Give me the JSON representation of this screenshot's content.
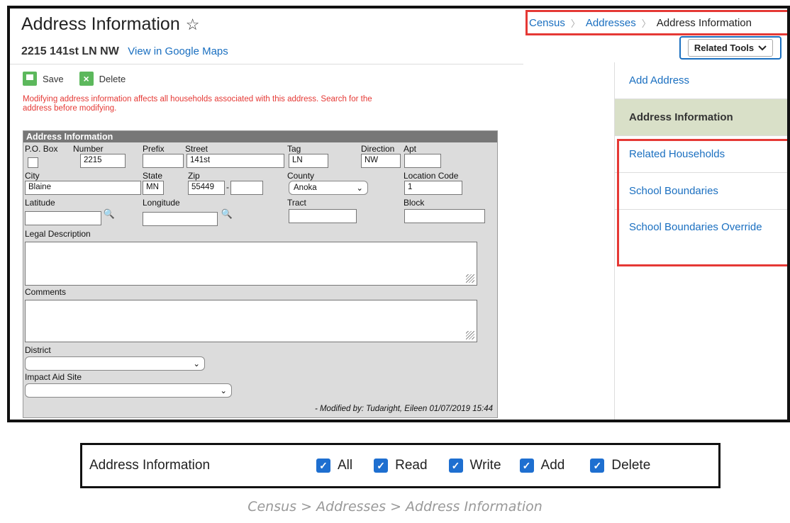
{
  "page": {
    "title": "Address Information",
    "address_line": "2215 141st LN NW",
    "maps_link": "View in Google Maps"
  },
  "breadcrumb": {
    "items": [
      "Census",
      "Addresses",
      "Address Information"
    ]
  },
  "related_tools": {
    "label": "Related Tools"
  },
  "right_panel": {
    "items": [
      {
        "label": "Add Address"
      },
      {
        "label": "Address Information"
      },
      {
        "label": "Related Households"
      },
      {
        "label": "School Boundaries"
      },
      {
        "label": "School Boundaries Override"
      }
    ]
  },
  "toolbar": {
    "save": "Save",
    "delete": "Delete"
  },
  "warning": "Modifying address information affects all households associated with this address. Search for the address before modifying.",
  "form": {
    "header": "Address Information",
    "labels": {
      "po_box": "P.O. Box",
      "number": "Number",
      "prefix": "Prefix",
      "street": "Street",
      "tag": "Tag",
      "direction": "Direction",
      "apt": "Apt",
      "city": "City",
      "state": "State",
      "zip": "Zip",
      "county": "County",
      "location_code": "Location Code",
      "latitude": "Latitude",
      "longitude": "Longitude",
      "tract": "Tract",
      "block": "Block",
      "legal_description": "Legal Description",
      "comments": "Comments",
      "district": "District",
      "impact_aid": "Impact Aid Site"
    },
    "values": {
      "number": "2215",
      "prefix": "",
      "street": "141st",
      "tag": "LN",
      "direction": "NW",
      "apt": "",
      "city": "Blaine",
      "state": "MN",
      "zip": "55449",
      "zip_ext": "",
      "county": "Anoka",
      "location_code": "1",
      "latitude": "",
      "longitude": "",
      "tract": "",
      "block": "",
      "district": "",
      "impact_aid": ""
    },
    "modified": "- Modified by: Tudaright, Eileen 01/07/2019 15:44"
  },
  "permissions": {
    "name": "Address Information",
    "options": [
      {
        "label": "All",
        "checked": true
      },
      {
        "label": "Read",
        "checked": true
      },
      {
        "label": "Write",
        "checked": true
      },
      {
        "label": "Add",
        "checked": true
      },
      {
        "label": "Delete",
        "checked": true
      }
    ]
  },
  "caption": "Census > Addresses > Address Information"
}
